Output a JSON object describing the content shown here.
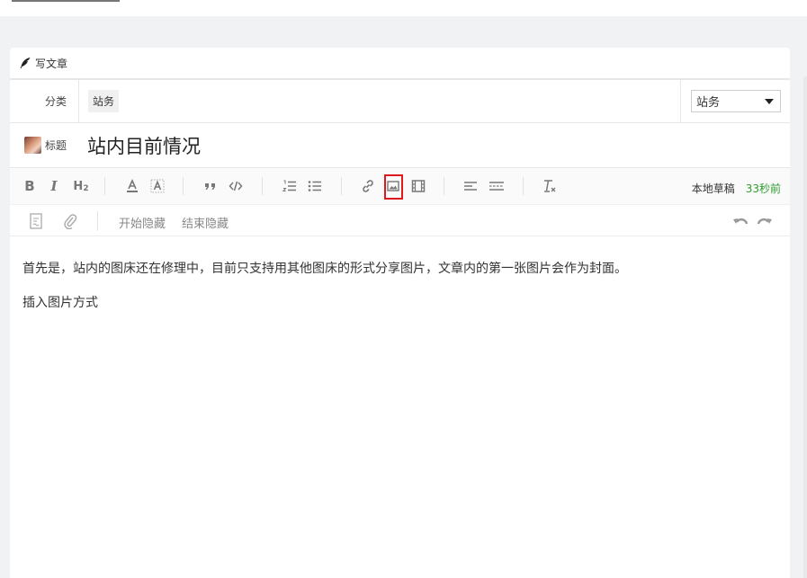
{
  "panel": {
    "title": "写文章"
  },
  "category": {
    "label": "分类",
    "tag": "站务",
    "select_value": "站务"
  },
  "title_row": {
    "label": "标题",
    "value": "站内目前情况"
  },
  "toolbar": {
    "draft_label": "本地草稿",
    "draft_time": "33秒前",
    "buttons": [
      "bold-icon",
      "italic-icon",
      "heading-icon",
      "font-color-icon",
      "background-color-icon",
      "quote-icon",
      "code-icon",
      "ordered-list-icon",
      "unordered-list-icon",
      "link-icon",
      "image-icon",
      "video-icon",
      "align-left-icon",
      "horizontal-rule-icon",
      "clear-format-icon"
    ],
    "highlighted": "image-icon"
  },
  "toolbar2": {
    "hide_start": "开始隐藏",
    "hide_end": "结束隐藏"
  },
  "content": {
    "paragraphs": [
      "首先是，站内的图床还在修理中，目前只支持用其他图床的形式分享图片，文章内的第一张图片会作为封面。",
      "插入图片方式"
    ]
  },
  "colors": {
    "highlight": "#e0191c",
    "draft_time": "#2e9d2e"
  }
}
